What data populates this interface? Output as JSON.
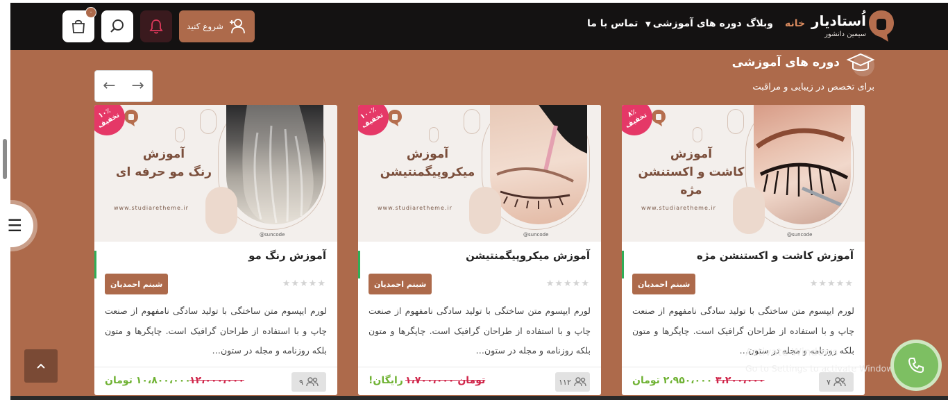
{
  "header": {
    "brand_title": "اُستادیار",
    "brand_subtitle": "سیمین دانشور",
    "nav": [
      {
        "label": "خانه",
        "active": true
      },
      {
        "label": "وبلاگ",
        "active": false
      },
      {
        "label": "دوره های آموزشی",
        "active": false,
        "has_dropdown": true
      },
      {
        "label": "تماس با ما",
        "active": false
      }
    ],
    "start_button": "شروع کنید",
    "cart_count": "۰",
    "icons": {
      "bell": "bell-icon",
      "search": "search-icon",
      "cart": "cart-icon",
      "user_add": "user-plus-icon"
    }
  },
  "section": {
    "title": "دوره های آموزشی",
    "subtitle": "برای تخصص در زیبایی و مراقبت"
  },
  "courses": [
    {
      "badge_pct": "۸٪",
      "badge_label": "تخفیف",
      "image_title_l1": "آموزش",
      "image_title_l2": "کاشت و اکستنشن مژه",
      "image_url": "www.studiaretheme.ir",
      "image_handle": "@suncode",
      "title": "آموزش کاشت و اکستنشن مژه",
      "author": "شبنم احمدیان",
      "description": "لورم ایپسوم متن ساختگی با تولید سادگی نامفهوم از صنعت چاپ و با استفاده از طراحان گرافیک است. چاپگرها و متون بلکه روزنامه و مجله در ستون…",
      "students": "۷",
      "old_price": "۳،۲۰۰،۰۰۰",
      "price": "۲،۹۵۰،۰۰۰ تومان",
      "rating": 0
    },
    {
      "badge_pct": "۱۰۰٪",
      "badge_label": "تخفیف",
      "image_title_l1": "آموزش",
      "image_title_l2": "میکروپیگمنتیشن",
      "image_url": "www.studiaretheme.ir",
      "image_handle": "@suncode",
      "title": "آموزش میکروپیگمنتیشن",
      "author": "شبنم احمدیان",
      "description": "لورم ایپسوم متن ساختگی با تولید سادگی نامفهوم از صنعت چاپ و با استفاده از طراحان گرافیک است. چاپگرها و متون بلکه روزنامه و مجله در ستون…",
      "students": "۱۱۲",
      "old_price": "۱،۷۰۰،۰۰۰ تومان",
      "price": "رایگان!",
      "rating": 0
    },
    {
      "badge_pct": "۱۰٪",
      "badge_label": "تخفیف",
      "image_title_l1": "آموزش",
      "image_title_l2": "رنگ مو حرفه ای",
      "image_url": "www.studiaretheme.ir",
      "image_handle": "@suncode",
      "title": "آموزش رنگ مو",
      "author": "شبنم احمدیان",
      "description": "لورم ایپسوم متن ساختگی با تولید سادگی نامفهوم از صنعت چاپ و با استفاده از طراحان گرافیک است. چاپگرها و متون بلکه روزنامه و مجله در ستون…",
      "students": "۹",
      "old_price": "۱۲،۰۰۰،۰۰۰",
      "price": "۱۰،۸۰۰،۰۰۰ تومان",
      "rating": 0
    }
  ],
  "watermark": {
    "line1": "Activate Windows",
    "line2": "Go to Settings to activate Windows."
  },
  "colors": {
    "brand": "#ad6a4b",
    "header_bg": "#141212",
    "badge": "#e53867",
    "price": "#6fb233",
    "old_price": "#d0264a"
  }
}
